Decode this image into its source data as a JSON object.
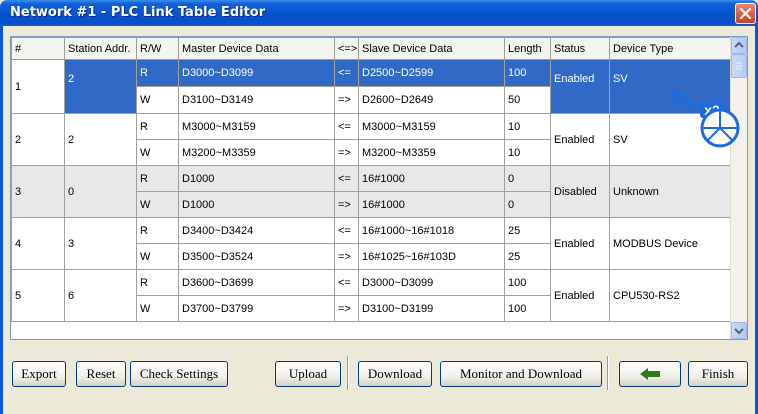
{
  "window": {
    "title": "Network #1 - PLC Link Table Editor"
  },
  "columns": [
    "#",
    "Station Addr.",
    "R/W",
    "Master Device Data",
    "<=>",
    "Slave Device Data",
    "Length",
    "Status",
    "Device Type"
  ],
  "rows": [
    {
      "num": "1",
      "station": "2",
      "status": "Enabled",
      "device_type": "SV",
      "r": {
        "rw": "R",
        "master": "D3000~D3099",
        "dir": "<=",
        "slave": "D2500~D2599",
        "length": "100"
      },
      "w": {
        "rw": "W",
        "master": "D3100~D3149",
        "dir": "=>",
        "slave": "D2600~D2649",
        "length": "50"
      }
    },
    {
      "num": "2",
      "station": "2",
      "status": "Enabled",
      "device_type": "SV",
      "r": {
        "rw": "R",
        "master": "M3000~M3159",
        "dir": "<=",
        "slave": "M3000~M3159",
        "length": "10"
      },
      "w": {
        "rw": "W",
        "master": "M3200~M3359",
        "dir": "=>",
        "slave": "M3200~M3359",
        "length": "10"
      }
    },
    {
      "num": "3",
      "station": "0",
      "status": "Disabled",
      "device_type": "Unknown",
      "r": {
        "rw": "R",
        "master": "D1000",
        "dir": "<=",
        "slave": "16#1000",
        "length": "0"
      },
      "w": {
        "rw": "W",
        "master": "D1000",
        "dir": "=>",
        "slave": "16#1000",
        "length": "0"
      }
    },
    {
      "num": "4",
      "station": "3",
      "status": "Enabled",
      "device_type": "MODBUS Device",
      "r": {
        "rw": "R",
        "master": "D3400~D3424",
        "dir": "<=",
        "slave": "16#1000~16#1018",
        "length": "25"
      },
      "w": {
        "rw": "W",
        "master": "D3500~D3524",
        "dir": "=>",
        "slave": "16#1025~16#103D",
        "length": "25"
      }
    },
    {
      "num": "5",
      "station": "6",
      "status": "Enabled",
      "device_type": "CPU530-RS2",
      "r": {
        "rw": "R",
        "master": "D3600~D3699",
        "dir": "<=",
        "slave": "D3000~D3099",
        "length": "100"
      },
      "w": {
        "rw": "W",
        "master": "D3700~D3799",
        "dir": "=>",
        "slave": "D3100~D3199",
        "length": "100"
      }
    }
  ],
  "annotation": {
    "label": "x2",
    "icon": "double-click-cursor-icon",
    "color": "#1E6BE0"
  },
  "buttons": {
    "export": "Export",
    "reset": "Reset",
    "check_settings": "Check Settings",
    "upload": "Upload",
    "download": "Download",
    "monitor_download": "Monitor and Download",
    "back_icon": "left-arrow-icon",
    "finish": "Finish"
  },
  "colors": {
    "selection": "#3169C6",
    "titlebar": "#0A55D8",
    "back_arrow": "#2E7D1A"
  }
}
